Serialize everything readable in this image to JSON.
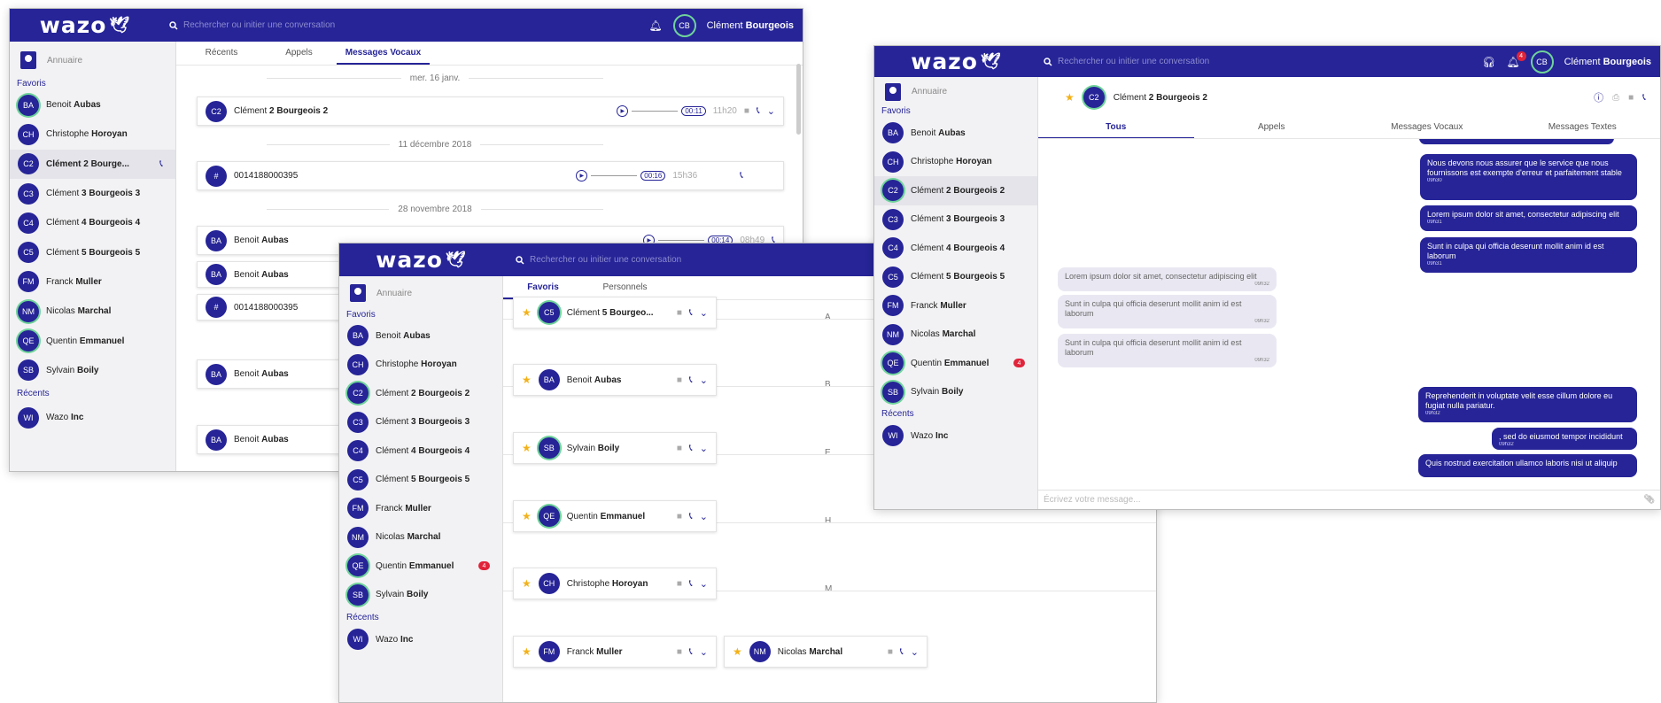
{
  "brand": "wazo",
  "search_placeholder": "Rechercher ou initier une conversation",
  "user": {
    "initials": "CB",
    "first": "Clément",
    "last": "Bourgeois"
  },
  "sidebar": {
    "directory": "Annuaire",
    "favorites_label": "Favoris",
    "recents_label": "Récents",
    "favorites": [
      {
        "initials": "BA",
        "first": "Benoit",
        "last": "Aubas"
      },
      {
        "initials": "CH",
        "first": "Christophe",
        "last": "Horoyan"
      },
      {
        "initials": "C2",
        "first": "Clément",
        "last": "2 Bourgeois 2"
      },
      {
        "initials": "C3",
        "first": "Clément",
        "last": "3 Bourgeois 3"
      },
      {
        "initials": "C4",
        "first": "Clément",
        "last": "4 Bourgeois 4"
      },
      {
        "initials": "C5",
        "first": "Clément",
        "last": "5 Bourgeois 5"
      },
      {
        "initials": "FM",
        "first": "Franck",
        "last": "Muller"
      },
      {
        "initials": "NM",
        "first": "Nicolas",
        "last": "Marchal"
      },
      {
        "initials": "QE",
        "first": "Quentin",
        "last": "Emmanuel",
        "badge": "4"
      },
      {
        "initials": "SB",
        "first": "Sylvain",
        "last": "Boily"
      }
    ],
    "recents": [
      {
        "initials": "WI",
        "first": "Wazo",
        "last": "Inc"
      }
    ],
    "w1_selected_label": "Clément 2 Bourge..."
  },
  "window1": {
    "tabs": [
      "Récents",
      "Appels",
      "Messages Vocaux"
    ],
    "date1": "mer. 16 janv.",
    "date2": "11 décembre 2018",
    "date3": "28 novembre 2018",
    "vm1": {
      "initials": "C2",
      "first": "Clément",
      "last": "2 Bourgeois 2",
      "duration": "00:11",
      "time": "11h20"
    },
    "vm2": {
      "initials": "#",
      "number": "0014188000395",
      "duration": "00:16",
      "time": "15h36"
    },
    "vm3": {
      "initials": "BA",
      "first": "Benoit",
      "last": "Aubas",
      "duration": "00:14",
      "time": "08h49"
    },
    "vm4": {
      "initials": "BA",
      "first": "Benoit",
      "last": "Aubas"
    },
    "vm5": {
      "initials": "#",
      "number": "0014188000395"
    },
    "vm6": {
      "initials": "BA",
      "first": "Benoit",
      "last": "Aubas"
    },
    "vm7": {
      "initials": "BA",
      "first": "Benoit",
      "last": "Aubas"
    }
  },
  "window2": {
    "tabs": [
      "Favoris",
      "Personnels"
    ],
    "letters": [
      "A",
      "B",
      "E",
      "H",
      "M"
    ],
    "cards": [
      {
        "initials": "C5",
        "first": "Clément",
        "last": "5 Bourgeo..."
      },
      {
        "initials": "BA",
        "first": "Benoit",
        "last": "Aubas"
      },
      {
        "initials": "SB",
        "first": "Sylvain",
        "last": "Boily"
      },
      {
        "initials": "QE",
        "first": "Quentin",
        "last": "Emmanuel"
      },
      {
        "initials": "CH",
        "first": "Christophe",
        "last": "Horoyan"
      },
      {
        "initials": "FM",
        "first": "Franck",
        "last": "Muller"
      },
      {
        "initials": "NM",
        "first": "Nicolas",
        "last": "Marchal"
      }
    ]
  },
  "window3": {
    "notif_count": "4",
    "contact": {
      "initials": "C2",
      "first": "Clément",
      "last": "2 Bourgeois 2"
    },
    "tabs": [
      "Tous",
      "Appels",
      "Messages Vocaux",
      "Messages Textes"
    ],
    "messages": [
      {
        "side": "me",
        "text": "Nous devons nous assurer que le service que nous fournissons est exempte d'erreur et parfaitement stable",
        "time": "09h30"
      },
      {
        "side": "me",
        "text": "Lorem ipsum dolor sit amet, consectetur adipiscing elit",
        "time": "09h31"
      },
      {
        "side": "me",
        "text": "Sunt in culpa qui officia deserunt mollit anim id est laborum",
        "time": "09h31"
      },
      {
        "side": "them",
        "text": "Lorem ipsum dolor sit amet, consectetur adipiscing elit",
        "time": "09h32"
      },
      {
        "side": "them",
        "text": "Sunt in culpa qui officia deserunt mollit anim id est laborum",
        "time": "09h32"
      },
      {
        "side": "them",
        "text": "Sunt in culpa qui officia deserunt mollit anim id est laborum",
        "time": "09h32"
      },
      {
        "side": "me",
        "text": "Reprehenderit in voluptate velit esse cillum dolore eu fugiat nulla pariatur.",
        "time": "09h32"
      },
      {
        "side": "me",
        "text": ", sed do eiusmod tempor incididunt",
        "time": "09h32"
      },
      {
        "side": "me",
        "text": "Quis nostrud exercitation ullamco laboris nisi ut aliquip",
        "time": ""
      }
    ],
    "composer_placeholder": "Écrivez votre message..."
  }
}
